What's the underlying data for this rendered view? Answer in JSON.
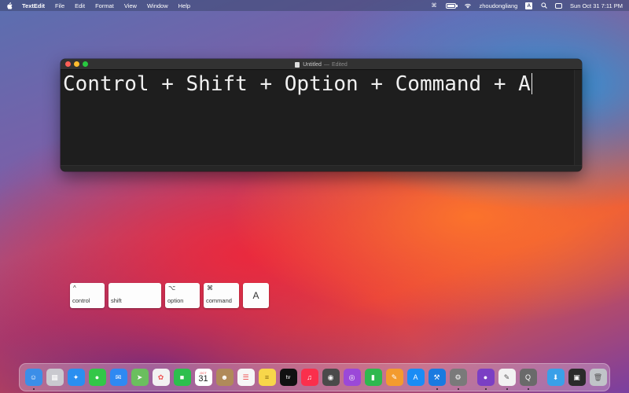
{
  "menubar": {
    "app_name": "TextEdit",
    "menus": [
      "File",
      "Edit",
      "Format",
      "View",
      "Window",
      "Help"
    ],
    "username": "zhoudongliang",
    "input_badge": "A",
    "datetime": "Sun Oct 31  7:11 PM",
    "icons": [
      "apple-icon",
      "command-icon",
      "battery-icon",
      "wifi-icon",
      "input-source-icon",
      "spotlight-icon",
      "control-center-icon"
    ]
  },
  "window": {
    "title": "Untitled",
    "separator": "—",
    "status": "Edited",
    "content": "Control + Shift + Option + Command + A"
  },
  "keys": [
    {
      "symbol": "^",
      "label": "control"
    },
    {
      "symbol": "",
      "label": "shift"
    },
    {
      "symbol": "⌥",
      "label": "option"
    },
    {
      "symbol": "⌘",
      "label": "command"
    },
    {
      "symbol": "",
      "label": "A"
    }
  ],
  "dock": {
    "calendar_month": "OCT",
    "calendar_day": "31",
    "apps": [
      "finder",
      "launchpad",
      "safari",
      "messages",
      "mail",
      "maps",
      "photos",
      "facetime",
      "calendar",
      "contacts",
      "reminders",
      "notes",
      "tv",
      "music",
      "screenshot",
      "podcasts",
      "numbers",
      "pages",
      "app-store",
      "xcode",
      "system-preferences",
      "github-desktop",
      "textedit",
      "quicktime",
      "downloads",
      "screen-recorder",
      "trash"
    ],
    "colors": {
      "finder": "#3b8ee8",
      "launchpad": "#c9c9cf",
      "safari": "#2a8ff0",
      "messages": "#33c748",
      "mail": "#2f89f2",
      "maps": "#6bbf5e",
      "photos": "#f2f2f2",
      "facetime": "#2dbf4e",
      "contacts": "#b08a5a",
      "reminders": "#f6f6f6",
      "notes": "#f7d64a",
      "tv": "#111111",
      "music": "#fa2f4c",
      "screenshot": "#4a4a4a",
      "podcasts": "#9b48d8",
      "numbers": "#2fb84f",
      "pages": "#f39b2e",
      "app-store": "#1a8cf5",
      "xcode": "#1a7ae0",
      "system-preferences": "#7a7a7a",
      "github-desktop": "#7b3fc4",
      "textedit": "#f2f2f2",
      "quicktime": "#6a6a6a",
      "downloads": "#3aa0e8",
      "screen-recorder": "#2a2a2a",
      "trash": "#c0c4c8"
    }
  }
}
